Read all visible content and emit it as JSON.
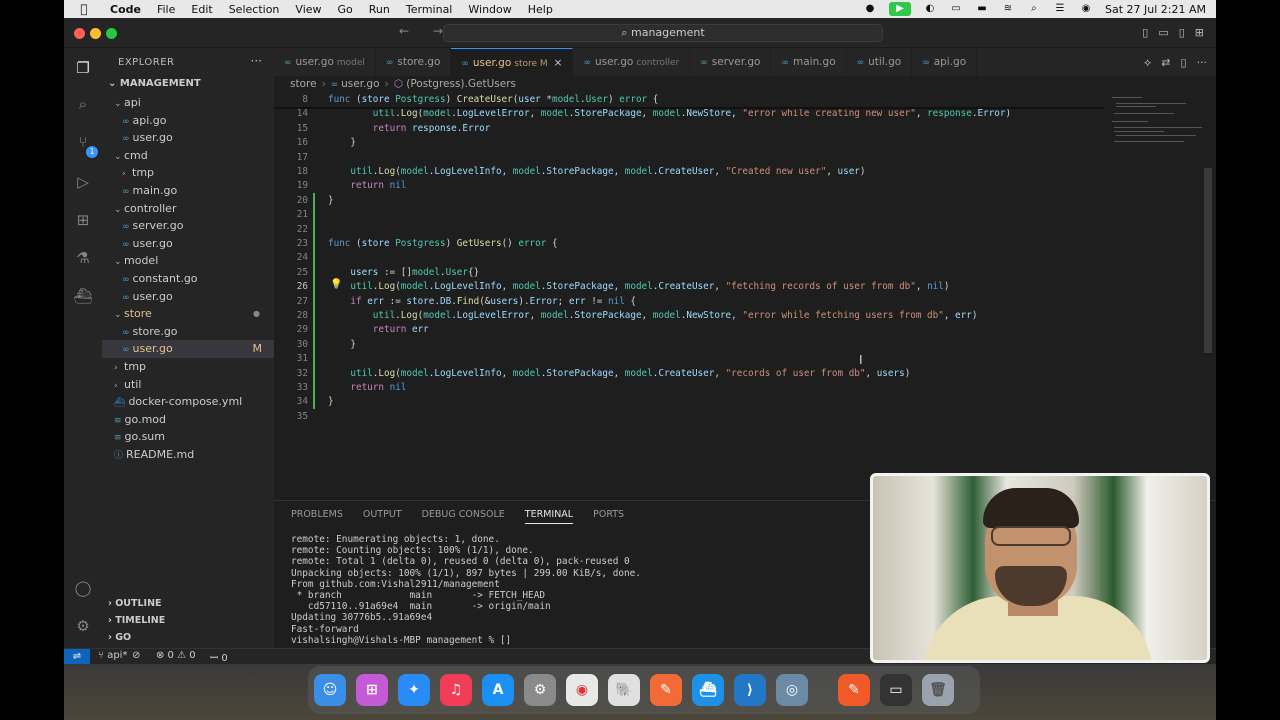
{
  "menubar": {
    "app_name": "Code",
    "items": [
      "File",
      "Edit",
      "Selection",
      "View",
      "Go",
      "Run",
      "Terminal",
      "Window",
      "Help"
    ],
    "datetime": "Sat 27 Jul  2:21 AM"
  },
  "window": {
    "search_text": "management"
  },
  "sidebar": {
    "header": "EXPLORER",
    "root": "MANAGEMENT",
    "tree": [
      {
        "label": "api",
        "type": "folder",
        "indent": 1
      },
      {
        "label": "api.go",
        "type": "go",
        "indent": 2
      },
      {
        "label": "user.go",
        "type": "go",
        "indent": 2
      },
      {
        "label": "cmd",
        "type": "folder",
        "indent": 1
      },
      {
        "label": "tmp",
        "type": "folder-closed",
        "indent": 2
      },
      {
        "label": "main.go",
        "type": "go",
        "indent": 2
      },
      {
        "label": "controller",
        "type": "folder",
        "indent": 1
      },
      {
        "label": "server.go",
        "type": "go",
        "indent": 2
      },
      {
        "label": "user.go",
        "type": "go",
        "indent": 2
      },
      {
        "label": "model",
        "type": "folder",
        "indent": 1
      },
      {
        "label": "constant.go",
        "type": "go",
        "indent": 2
      },
      {
        "label": "user.go",
        "type": "go",
        "indent": 2
      },
      {
        "label": "store",
        "type": "folder-mod",
        "indent": 1
      },
      {
        "label": "store.go",
        "type": "go",
        "indent": 2
      },
      {
        "label": "user.go",
        "type": "go-selected",
        "indent": 2,
        "badge": "M"
      },
      {
        "label": "tmp",
        "type": "folder-closed",
        "indent": 1
      },
      {
        "label": "util",
        "type": "folder-closed",
        "indent": 1
      },
      {
        "label": "docker-compose.yml",
        "type": "docker",
        "indent": 1
      },
      {
        "label": "go.mod",
        "type": "gomod",
        "indent": 1
      },
      {
        "label": "go.sum",
        "type": "gomod",
        "indent": 1
      },
      {
        "label": "README.md",
        "type": "info",
        "indent": 1
      }
    ],
    "sections": [
      "OUTLINE",
      "TIMELINE",
      "GO"
    ]
  },
  "tabs": [
    {
      "label": "user.go",
      "desc": "model",
      "active": false
    },
    {
      "label": "store.go",
      "desc": "",
      "active": false
    },
    {
      "label": "user.go",
      "desc": "store M",
      "active": true
    },
    {
      "label": "user.go",
      "desc": "controller",
      "active": false
    },
    {
      "label": "server.go",
      "desc": "",
      "active": false
    },
    {
      "label": "main.go",
      "desc": "",
      "active": false
    },
    {
      "label": "util.go",
      "desc": "",
      "active": false
    },
    {
      "label": "api.go",
      "desc": "",
      "active": false
    }
  ],
  "breadcrumb": [
    "store",
    "user.go",
    "(Postgress).GetUsers"
  ],
  "code_lines": [
    {
      "n": "8",
      "html": "<span class='kw'>func</span> (<span class='va'>store</span> <span class='ty'>Postgress</span>) <span class='fn'>CreateUser</span>(<span class='va'>user</span> *<span class='ty'>model</span>.<span class='ty'>User</span>) <span class='ty'>error</span> {"
    },
    {
      "n": "14",
      "html": "        <span class='ty'>util</span>.<span class='fn'>Log</span>(<span class='ty'>model</span>.<span class='va'>LogLevelError</span>, <span class='ty'>model</span>.<span class='va'>StorePackage</span>, <span class='ty'>model</span>.<span class='va'>NewStore</span>, <span class='st'>\"error while creating new user\"</span>, <span class='ty'>response</span>.<span class='va'>Error</span>)"
    },
    {
      "n": "15",
      "html": "        <span class='ctl'>return</span> <span class='va'>response</span>.<span class='va'>Error</span>"
    },
    {
      "n": "16",
      "html": "    }"
    },
    {
      "n": "17",
      "html": ""
    },
    {
      "n": "18",
      "html": "    <span class='ty'>util</span>.<span class='fn'>Log</span>(<span class='ty'>model</span>.<span class='va'>LogLevelInfo</span>, <span class='ty'>model</span>.<span class='va'>StorePackage</span>, <span class='ty'>model</span>.<span class='va'>CreateUser</span>, <span class='st'>\"Created new user\"</span>, <span class='va'>user</span>)"
    },
    {
      "n": "19",
      "html": "    <span class='ctl'>return</span> <span class='kw'>nil</span>"
    },
    {
      "n": "20",
      "html": "}"
    },
    {
      "n": "21",
      "html": ""
    },
    {
      "n": "22",
      "html": ""
    },
    {
      "n": "23",
      "html": "<span class='kw'>func</span> (<span class='va'>store</span> <span class='ty'>Postgress</span>) <span class='fn'>GetUsers</span>() <span class='ty'>error</span> {"
    },
    {
      "n": "24",
      "html": ""
    },
    {
      "n": "25",
      "html": "    <span class='va'>users</span> := []<span class='ty'>model</span>.<span class='ty'>User</span>{}"
    },
    {
      "n": "26",
      "html": "    <span class='ty'>util</span>.<span class='fn'>Log</span>(<span class='ty'>model</span>.<span class='va'>LogLevelInfo</span>, <span class='ty'>model</span>.<span class='va'>StorePackage</span>, <span class='ty'>model</span>.<span class='va'>CreateUser</span>, <span class='st'>\"fetching records of user from db\"</span>, <span class='kw'>nil</span>)",
      "current": true
    },
    {
      "n": "27",
      "html": "    <span class='ctl'>if</span> <span class='va'>err</span> := <span class='va'>store</span>.<span class='va'>DB</span>.<span class='fn'>Find</span>(&amp;<span class='va'>users</span>).<span class='va'>Error</span>; <span class='va'>err</span> != <span class='kw'>nil</span> {"
    },
    {
      "n": "28",
      "html": "        <span class='ty'>util</span>.<span class='fn'>Log</span>(<span class='ty'>model</span>.<span class='va'>LogLevelError</span>, <span class='ty'>model</span>.<span class='va'>StorePackage</span>, <span class='ty'>model</span>.<span class='va'>NewStore</span>, <span class='st'>\"error while fetching users from db\"</span>, <span class='va'>err</span>)"
    },
    {
      "n": "29",
      "html": "        <span class='ctl'>return</span> <span class='va'>err</span>"
    },
    {
      "n": "30",
      "html": "    }"
    },
    {
      "n": "31",
      "html": ""
    },
    {
      "n": "32",
      "html": "    <span class='ty'>util</span>.<span class='fn'>Log</span>(<span class='ty'>model</span>.<span class='va'>LogLevelInfo</span>, <span class='ty'>model</span>.<span class='va'>StorePackage</span>, <span class='ty'>model</span>.<span class='va'>CreateUser</span>, <span class='st'>\"records of user from db\"</span>, <span class='va'>users</span>)"
    },
    {
      "n": "33",
      "html": "    <span class='ctl'>return</span> <span class='kw'>nil</span>"
    },
    {
      "n": "34",
      "html": "}"
    },
    {
      "n": "35",
      "html": ""
    }
  ],
  "panel": {
    "tabs": [
      "PROBLEMS",
      "OUTPUT",
      "DEBUG CONSOLE",
      "TERMINAL",
      "PORTS"
    ],
    "active_tab": "TERMINAL",
    "terminal_lines": [
      "remote: Enumerating objects: 1, done.",
      "remote: Counting objects: 100% (1/1), done.",
      "remote: Total 1 (delta 0), reused 0 (delta 0), pack-reused 0",
      "Unpacking objects: 100% (1/1), 897 bytes | 299.00 KiB/s, done.",
      "From github.com:Vishal2911/management",
      " * branch            main       -> FETCH_HEAD",
      "   cd57110..91a69e4  main       -> origin/main",
      "Updating 30776b5..91a69e4",
      "Fast-forward",
      "vishalsingh@Vishals-MBP management % []"
    ]
  },
  "statusbar": {
    "branch": "api*",
    "sync": "⊘",
    "errors": "⊗ 0 ⚠ 0",
    "ports": "ꟷ 0"
  },
  "colors": {
    "accent": "#3794ff",
    "modified": "#e2c08d",
    "remote": "#0e63bc"
  }
}
